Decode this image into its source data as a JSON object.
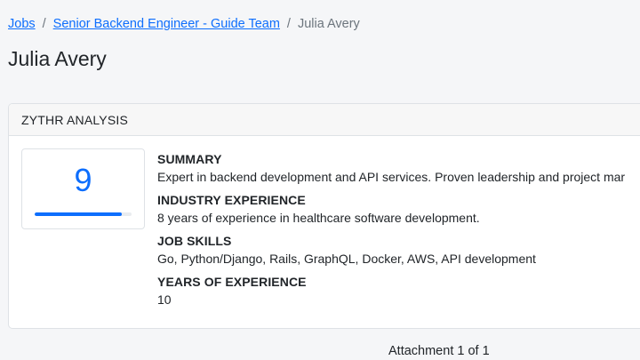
{
  "breadcrumb": {
    "jobs_label": "Jobs",
    "separator": "/",
    "job_label": "Senior Backend Engineer - Guide Team",
    "current_label": "Julia Avery"
  },
  "page": {
    "title": "Julia Avery"
  },
  "analysis": {
    "header": "ZYTHR ANALYSIS",
    "score": "9",
    "score_fraction": 0.9,
    "sections": [
      {
        "heading": "SUMMARY",
        "text": "Expert in backend development and API services. Proven leadership and project mar"
      },
      {
        "heading": "INDUSTRY EXPERIENCE",
        "text": "8 years of experience in healthcare software development."
      },
      {
        "heading": "JOB SKILLS",
        "text": "Go, Python/Django, Rails, GraphQL, Docker, AWS, API development"
      },
      {
        "heading": "YEARS OF EXPERIENCE",
        "text": "10"
      }
    ]
  },
  "attachment": {
    "label": "Attachment 1 of 1"
  },
  "colors": {
    "accent": "#0d6efd",
    "muted": "#6c757d",
    "border": "#dee2e6"
  }
}
